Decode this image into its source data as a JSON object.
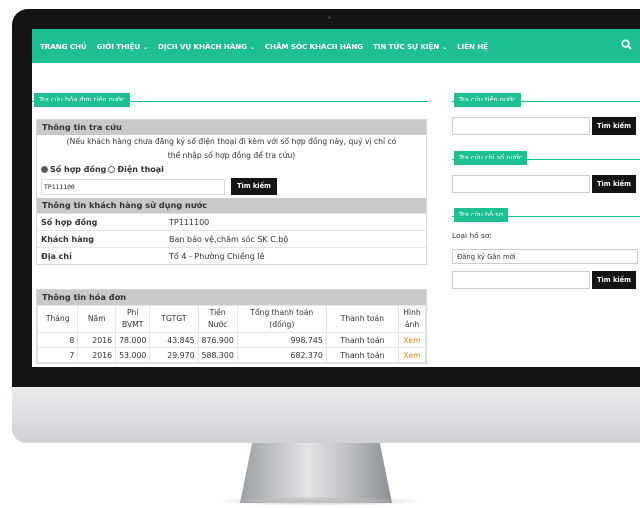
{
  "nav": {
    "items": [
      {
        "label": "TRANG CHỦ",
        "dropdown": false
      },
      {
        "label": "GIỚI THIỆU",
        "dropdown": true
      },
      {
        "label": "DỊCH VỤ KHÁCH HÀNG",
        "dropdown": true
      },
      {
        "label": "CHĂM SÓC KHÁCH HÀNG",
        "dropdown": false
      },
      {
        "label": "TIN TỨC SỰ KIỆN",
        "dropdown": true
      },
      {
        "label": "LIÊN HỆ",
        "dropdown": false
      }
    ],
    "search_icon": "search-icon"
  },
  "main": {
    "section_title": "Tra cứu hóa đơn tiền nước",
    "lookup": {
      "heading": "Thông tin tra cứu",
      "note_line1": "(Nếu khách hàng chưa đăng ký số điện thoại đi kèm với số hợp đồng này, quý vị chỉ có",
      "note_line2": "thể nhập số hợp đồng để tra cứu)",
      "option_contract": "Số hợp đồng",
      "option_phone": "Điện thoại",
      "selected_option": "Số hợp đồng",
      "input_value": "TP111100",
      "search_button": "Tìm kiếm"
    },
    "customer": {
      "heading": "Thông tin khách hàng sử dụng nước",
      "rows": [
        {
          "label": "Số hợp đồng",
          "value": "TP111100"
        },
        {
          "label": "Khách hàng",
          "value": "Ban bảo vệ,chăm sóc SK C.bộ"
        },
        {
          "label": "Địa chỉ",
          "value": "Tổ 4 - Phường Chiềng lê"
        }
      ]
    },
    "bills": {
      "heading": "Thông tin hóa đơn",
      "columns": [
        "Tháng",
        "Năm",
        "Phí BVMT",
        "TGTGT",
        "Tiền Nước",
        "Tổng thanh toán (đồng)",
        "Thanh toán",
        "Hình ảnh"
      ],
      "rows": [
        {
          "month": "8",
          "year": "2016",
          "fee": "78.000",
          "vat": "43.845",
          "water": "876.900",
          "total": "998.745",
          "status": "Thanh toán",
          "image": "Xem"
        },
        {
          "month": "7",
          "year": "2016",
          "fee": "53.000",
          "vat": "29.970",
          "water": "588.300",
          "total": "682.370",
          "status": "Thanh toán",
          "image": "Xem"
        }
      ]
    }
  },
  "sidebar": {
    "water_price": {
      "title": "Tra cứu tiền nước",
      "button": "Tìm kiếm"
    },
    "meter_index": {
      "title": "Tra cứu chỉ số nước",
      "button": "Tìm kiếm"
    },
    "records": {
      "title": "Tra cứu hồ sơ",
      "type_label": "Loại hồ sơ:",
      "type_value": "Đăng ký Gắn mới",
      "button": "Tìm kiếm"
    }
  },
  "colors": {
    "accent": "#1dbf93",
    "link": "#e08a1e",
    "button": "#141414",
    "bezel": "#141414"
  }
}
